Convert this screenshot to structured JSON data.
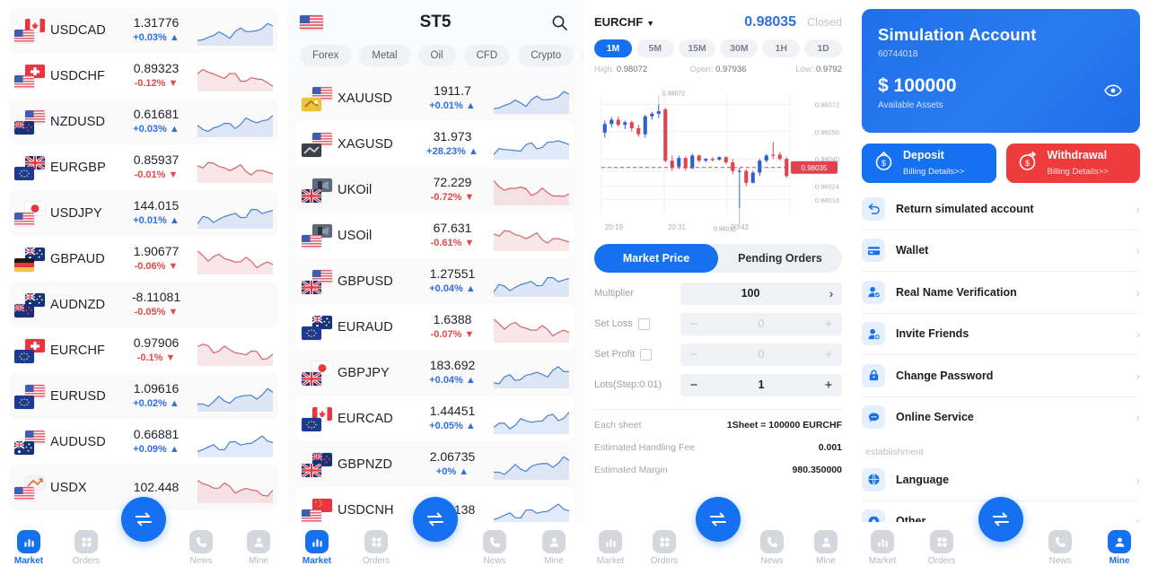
{
  "accent": "#1571f0",
  "up_color": "#2f6fe0",
  "down_color": "#e04a4a",
  "watchlist": {
    "rows": [
      {
        "symbol": "USDCAD",
        "price": "1.31776",
        "change": "+0.03%",
        "dir": "up",
        "flag_back": "ca",
        "flag_front": "us",
        "spark": "up"
      },
      {
        "symbol": "USDCHF",
        "price": "0.89323",
        "change": "-0.12%",
        "dir": "down",
        "flag_back": "ch",
        "flag_front": "us",
        "spark": "down"
      },
      {
        "symbol": "NZDUSD",
        "price": "0.61681",
        "change": "+0.03%",
        "dir": "up",
        "flag_back": "us",
        "flag_front": "nz",
        "spark": "up"
      },
      {
        "symbol": "EURGBP",
        "price": "0.85937",
        "change": "-0.01%",
        "dir": "down",
        "flag_back": "gb",
        "flag_front": "eu",
        "spark": "down"
      },
      {
        "symbol": "USDJPY",
        "price": "144.015",
        "change": "+0.01%",
        "dir": "up",
        "flag_back": "jp",
        "flag_front": "us",
        "spark": "up"
      },
      {
        "symbol": "GBPAUD",
        "price": "1.90677",
        "change": "-0.06%",
        "dir": "down",
        "flag_back": "au",
        "flag_front": "de",
        "spark": "down"
      },
      {
        "symbol": "AUDNZD",
        "price": "-8.11081",
        "change": "-0.05%",
        "dir": "down",
        "flag_back": "au",
        "flag_front": "nz",
        "spark": "none"
      },
      {
        "symbol": "EURCHF",
        "price": "0.97906",
        "change": "-0.1%",
        "dir": "down",
        "flag_back": "ch",
        "flag_front": "eu",
        "spark": "down"
      },
      {
        "symbol": "EURUSD",
        "price": "1.09616",
        "change": "+0.02%",
        "dir": "up",
        "flag_back": "us",
        "flag_front": "eu",
        "spark": "up"
      },
      {
        "symbol": "AUDUSD",
        "price": "0.66881",
        "change": "+0.09%",
        "dir": "up",
        "flag_back": "us",
        "flag_front": "au",
        "spark": "up"
      },
      {
        "symbol": "USDX",
        "price": "102.448",
        "change": "",
        "dir": "down",
        "flag_back": "xx",
        "flag_front": "us",
        "spark": "down"
      }
    ]
  },
  "market": {
    "title": "ST5",
    "search_icon": "search-icon",
    "chips": [
      "Forex",
      "Metal",
      "Oil",
      "CFD",
      "Crypto",
      "S"
    ],
    "rows": [
      {
        "symbol": "XAUUSD",
        "price": "1911.7",
        "change": "+0.01%",
        "dir": "up",
        "flag_back": "us",
        "flag_front": "gold",
        "spark": "up"
      },
      {
        "symbol": "XAGUSD",
        "price": "31.973",
        "change": "+28.23%",
        "dir": "up",
        "flag_back": "us",
        "flag_front": "silver",
        "spark": "up"
      },
      {
        "symbol": "UKOil",
        "price": "72.229",
        "change": "-0.72%",
        "dir": "down",
        "flag_back": "oil",
        "flag_front": "gb",
        "spark": "down"
      },
      {
        "symbol": "USOil",
        "price": "67.631",
        "change": "-0.61%",
        "dir": "down",
        "flag_back": "oil",
        "flag_front": "us",
        "spark": "down"
      },
      {
        "symbol": "GBPUSD",
        "price": "1.27551",
        "change": "+0.04%",
        "dir": "up",
        "flag_back": "us",
        "flag_front": "gb",
        "spark": "up"
      },
      {
        "symbol": "EURAUD",
        "price": "1.6388",
        "change": "-0.07%",
        "dir": "down",
        "flag_back": "au",
        "flag_front": "eu",
        "spark": "down"
      },
      {
        "symbol": "GBPJPY",
        "price": "183.692",
        "change": "+0.04%",
        "dir": "up",
        "flag_back": "jp",
        "flag_front": "gb",
        "spark": "up"
      },
      {
        "symbol": "EURCAD",
        "price": "1.44451",
        "change": "+0.05%",
        "dir": "up",
        "flag_back": "ca",
        "flag_front": "eu",
        "spark": "up"
      },
      {
        "symbol": "GBPNZD",
        "price": "2.06735",
        "change": "+0%",
        "dir": "up",
        "flag_back": "nz",
        "flag_front": "gb",
        "spark": "up"
      },
      {
        "symbol": "USDCNH",
        "price": "7.22138",
        "change": "",
        "dir": "up",
        "flag_back": "cn",
        "flag_front": "us",
        "spark": "up"
      }
    ]
  },
  "trade": {
    "symbol": "EURCHF",
    "price": "0.98035",
    "status": "Closed",
    "timeframes": [
      "1M",
      "5M",
      "15M",
      "30M",
      "1H",
      "1D"
    ],
    "timeframe_active": "1M",
    "ohlc": {
      "high_label": "High:",
      "high": "0.98072",
      "open_label": "Open:",
      "open": "0.97936",
      "low_label": "Low:",
      "low": "0.9792"
    },
    "tabs": [
      "Market Price",
      "Pending Orders"
    ],
    "tab_active": "Market Price",
    "fields": {
      "multiplier_label": "Multiplier",
      "multiplier_value": "100",
      "set_loss_label": "Set Loss",
      "set_loss_value": "0",
      "set_profit_label": "Set Profit",
      "set_profit_value": "0",
      "lots_label": "Lots(Step:0.01)",
      "lots_value": "1"
    },
    "summary": [
      {
        "k": "Each sheet",
        "v": "1Sheet = 100000 EURCHF"
      },
      {
        "k": "Estimated Handling Fee",
        "v": "0.001"
      },
      {
        "k": "Estimated Margin",
        "v": "980.350000"
      }
    ]
  },
  "chart_data": {
    "type": "candlestick",
    "title": "EURCHF",
    "xlabel": "",
    "ylabel": "",
    "grid": true,
    "x_ticks": [
      "20:19",
      "20:31",
      "20:43"
    ],
    "y_ticks": [
      "0.98072",
      "0.98056",
      "0.98040",
      "0.98024",
      "0.98016"
    ],
    "ylim": [
      0.98008,
      0.98078
    ],
    "annotations": [
      {
        "text": "0.98072",
        "type": "high-marker"
      },
      {
        "text": "0.98011",
        "type": "low-marker"
      },
      {
        "text": "0.98035",
        "type": "current-price-tag"
      }
    ],
    "current_price": 0.98035,
    "candles": [
      {
        "o": 0.980555,
        "h": 0.980625,
        "l": 0.980525,
        "c": 0.980605,
        "dir": "up"
      },
      {
        "o": 0.980605,
        "h": 0.980645,
        "l": 0.980585,
        "c": 0.98063,
        "dir": "up"
      },
      {
        "o": 0.98063,
        "h": 0.98065,
        "l": 0.98059,
        "c": 0.9806,
        "dir": "down"
      },
      {
        "o": 0.9806,
        "h": 0.980625,
        "l": 0.980575,
        "c": 0.980615,
        "dir": "up"
      },
      {
        "o": 0.980615,
        "h": 0.980625,
        "l": 0.98056,
        "c": 0.98058,
        "dir": "down"
      },
      {
        "o": 0.98058,
        "h": 0.9806,
        "l": 0.98053,
        "c": 0.980545,
        "dir": "down"
      },
      {
        "o": 0.980545,
        "h": 0.98066,
        "l": 0.980525,
        "c": 0.98065,
        "dir": "up"
      },
      {
        "o": 0.98065,
        "h": 0.980675,
        "l": 0.98063,
        "c": 0.980665,
        "dir": "up"
      },
      {
        "o": 0.980665,
        "h": 0.98072,
        "l": 0.98064,
        "c": 0.98068,
        "dir": "up"
      },
      {
        "o": 0.98069,
        "h": 0.9807,
        "l": 0.98038,
        "c": 0.98039,
        "dir": "down"
      },
      {
        "o": 0.98039,
        "h": 0.98042,
        "l": 0.98033,
        "c": 0.98035,
        "dir": "down"
      },
      {
        "o": 0.980355,
        "h": 0.98042,
        "l": 0.98034,
        "c": 0.980405,
        "dir": "up"
      },
      {
        "o": 0.980405,
        "h": 0.980415,
        "l": 0.98033,
        "c": 0.980345,
        "dir": "down"
      },
      {
        "o": 0.980345,
        "h": 0.98043,
        "l": 0.98034,
        "c": 0.98042,
        "dir": "up"
      },
      {
        "o": 0.98042,
        "h": 0.980425,
        "l": 0.98038,
        "c": 0.98039,
        "dir": "down"
      },
      {
        "o": 0.98039,
        "h": 0.980405,
        "l": 0.98038,
        "c": 0.9804,
        "dir": "up"
      },
      {
        "o": 0.9804,
        "h": 0.98041,
        "l": 0.980385,
        "c": 0.980395,
        "dir": "down"
      },
      {
        "o": 0.980395,
        "h": 0.980415,
        "l": 0.98039,
        "c": 0.98041,
        "dir": "up"
      },
      {
        "o": 0.98041,
        "h": 0.980415,
        "l": 0.98037,
        "c": 0.98038,
        "dir": "down"
      },
      {
        "o": 0.98038,
        "h": 0.9804,
        "l": 0.98031,
        "c": 0.98033,
        "dir": "down"
      },
      {
        "o": 0.98033,
        "h": 0.98035,
        "l": 0.98011,
        "c": 0.98033,
        "dir": "up"
      },
      {
        "o": 0.98033,
        "h": 0.98034,
        "l": 0.98024,
        "c": 0.98026,
        "dir": "down"
      },
      {
        "o": 0.98026,
        "h": 0.98033,
        "l": 0.980255,
        "c": 0.98032,
        "dir": "up"
      },
      {
        "o": 0.98032,
        "h": 0.9804,
        "l": 0.9803,
        "c": 0.98039,
        "dir": "up"
      },
      {
        "o": 0.98039,
        "h": 0.98043,
        "l": 0.98038,
        "c": 0.98042,
        "dir": "up"
      },
      {
        "o": 0.98042,
        "h": 0.9805,
        "l": 0.9804,
        "c": 0.980425,
        "dir": "down"
      },
      {
        "o": 0.980425,
        "h": 0.98044,
        "l": 0.98039,
        "c": 0.9804,
        "dir": "down"
      },
      {
        "o": 0.9804,
        "h": 0.98041,
        "l": 0.98029,
        "c": 0.9803,
        "dir": "down"
      }
    ]
  },
  "account": {
    "name": "Simulation Account",
    "id": "60744018",
    "balance": "$ 100000",
    "balance_caption": "Available Assets",
    "eye_icon": "eye-icon",
    "deposit": {
      "title": "Deposit",
      "sub": "Billing Details>>",
      "icon": "deposit-icon"
    },
    "withdrawal": {
      "title": "Withdrawal",
      "sub": "Billing Details>>",
      "icon": "withdrawal-icon"
    },
    "menu": [
      {
        "label": "Return simulated account",
        "icon": "undo-icon"
      },
      {
        "label": "Wallet",
        "icon": "card-icon"
      },
      {
        "label": "Real Name Verification",
        "icon": "user-check-icon"
      },
      {
        "label": "Invite Friends",
        "icon": "user-plus-icon"
      },
      {
        "label": "Change Password",
        "icon": "lock-icon"
      },
      {
        "label": "Online Service",
        "icon": "chat-icon"
      }
    ],
    "group_title": "establishment",
    "menu2": [
      {
        "label": "Language",
        "icon": "globe-icon"
      },
      {
        "label": "Other",
        "icon": "gear-icon"
      }
    ]
  },
  "tabbar": {
    "items": [
      {
        "label": "Market",
        "icon": "bar-chart-icon"
      },
      {
        "label": "Orders",
        "icon": "grid-icon"
      },
      {
        "label": "News",
        "icon": "phone-icon"
      },
      {
        "label": "Mine",
        "icon": "person-icon"
      }
    ],
    "fab_icon": "swap-icon",
    "active_s1": "Market",
    "active_s2": "Market",
    "active_s3": "",
    "active_s4": "Mine"
  }
}
